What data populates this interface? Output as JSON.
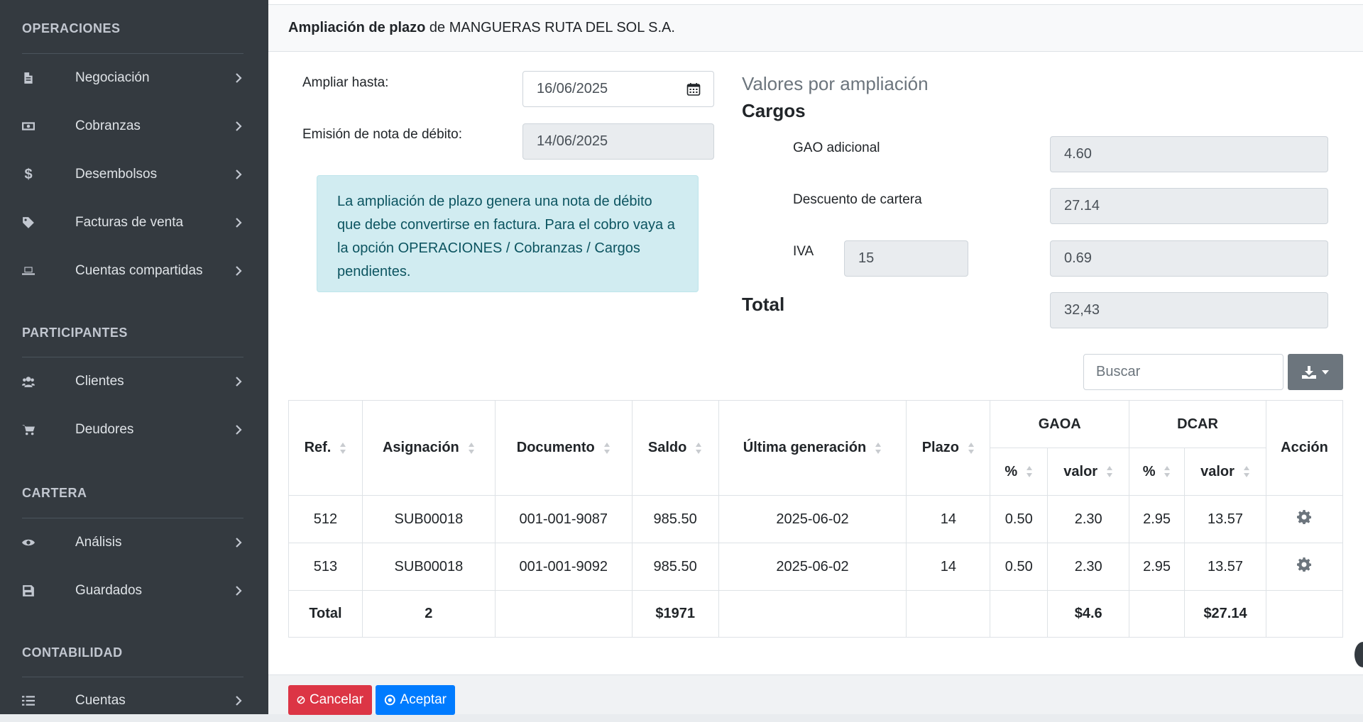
{
  "sidebar": {
    "sections": [
      {
        "title": "OPERACIONES",
        "items": [
          {
            "label": "Negociación",
            "icon": "file-icon"
          },
          {
            "label": "Cobranzas",
            "icon": "money-icon"
          },
          {
            "label": "Desembolsos",
            "icon": "dollar-icon"
          },
          {
            "label": "Facturas de venta",
            "icon": "tag-icon"
          },
          {
            "label": "Cuentas compartidas",
            "icon": "laptop-icon"
          }
        ]
      },
      {
        "title": "PARTICIPANTES",
        "items": [
          {
            "label": "Clientes",
            "icon": "users-icon"
          },
          {
            "label": "Deudores",
            "icon": "cart-icon"
          }
        ]
      },
      {
        "title": "CARTERA",
        "items": [
          {
            "label": "Análisis",
            "icon": "eye-icon"
          },
          {
            "label": "Guardados",
            "icon": "save-icon"
          }
        ]
      },
      {
        "title": "CONTABILIDAD",
        "items": [
          {
            "label": "Cuentas",
            "icon": "list-icon"
          }
        ]
      }
    ]
  },
  "header": {
    "title_bold": "Ampliación de plazo",
    "title_rest": " de MANGUERAS RUTA DEL SOL S.A."
  },
  "form": {
    "ampliar_label": "Ampliar hasta:",
    "ampliar_value": "16/06/2025",
    "emision_label": "Emisión de nota de débito:",
    "emision_value": "14/06/2025",
    "alert_text": "La ampliación de plazo genera una nota de débito que debe convertirse en factura. Para el cobro vaya a la opción OPERACIONES / Cobranzas / Cargos pendientes."
  },
  "values": {
    "heading": "Valores por ampliación",
    "cargos_heading": "Cargos",
    "gao_label": "GAO adicional",
    "gao_value": "4.60",
    "descuento_label": "Descuento de cartera",
    "descuento_value": "27.14",
    "iva_label": "IVA",
    "iva_rate": "15",
    "iva_value": "0.69",
    "total_label": "Total",
    "total_value": "32,43"
  },
  "table": {
    "search_placeholder": "Buscar",
    "headers": {
      "ref": "Ref.",
      "asignacion": "Asignación",
      "documento": "Documento",
      "saldo": "Saldo",
      "ultima": "Última generación",
      "plazo": "Plazo",
      "gaoa": "GAOA",
      "dcar": "DCAR",
      "accion": "Acción",
      "pct": "%",
      "valor": "valor"
    },
    "rows": [
      {
        "ref": "512",
        "asignacion": "SUB00018",
        "documento": "001-001-9087",
        "saldo": "985.50",
        "ultima": "2025-06-02",
        "plazo": "14",
        "gaoa_pct": "0.50",
        "gaoa_val": "2.30",
        "dcar_pct": "2.95",
        "dcar_val": "13.57"
      },
      {
        "ref": "513",
        "asignacion": "SUB00018",
        "documento": "001-001-9092",
        "saldo": "985.50",
        "ultima": "2025-06-02",
        "plazo": "14",
        "gaoa_pct": "0.50",
        "gaoa_val": "2.30",
        "dcar_pct": "2.95",
        "dcar_val": "13.57"
      }
    ],
    "totals": {
      "label": "Total",
      "asignacion": "2",
      "saldo": "$1971",
      "gaoa_val": "$4.6",
      "dcar_val": "$27.14"
    }
  },
  "footer": {
    "cancel_label": "Cancelar",
    "ok_label": "Aceptar"
  },
  "colors": {
    "sidebar_bg": "#343a40",
    "alert_bg": "#d1ecf1",
    "cancel": "#dc3545",
    "accept": "#007bff"
  }
}
